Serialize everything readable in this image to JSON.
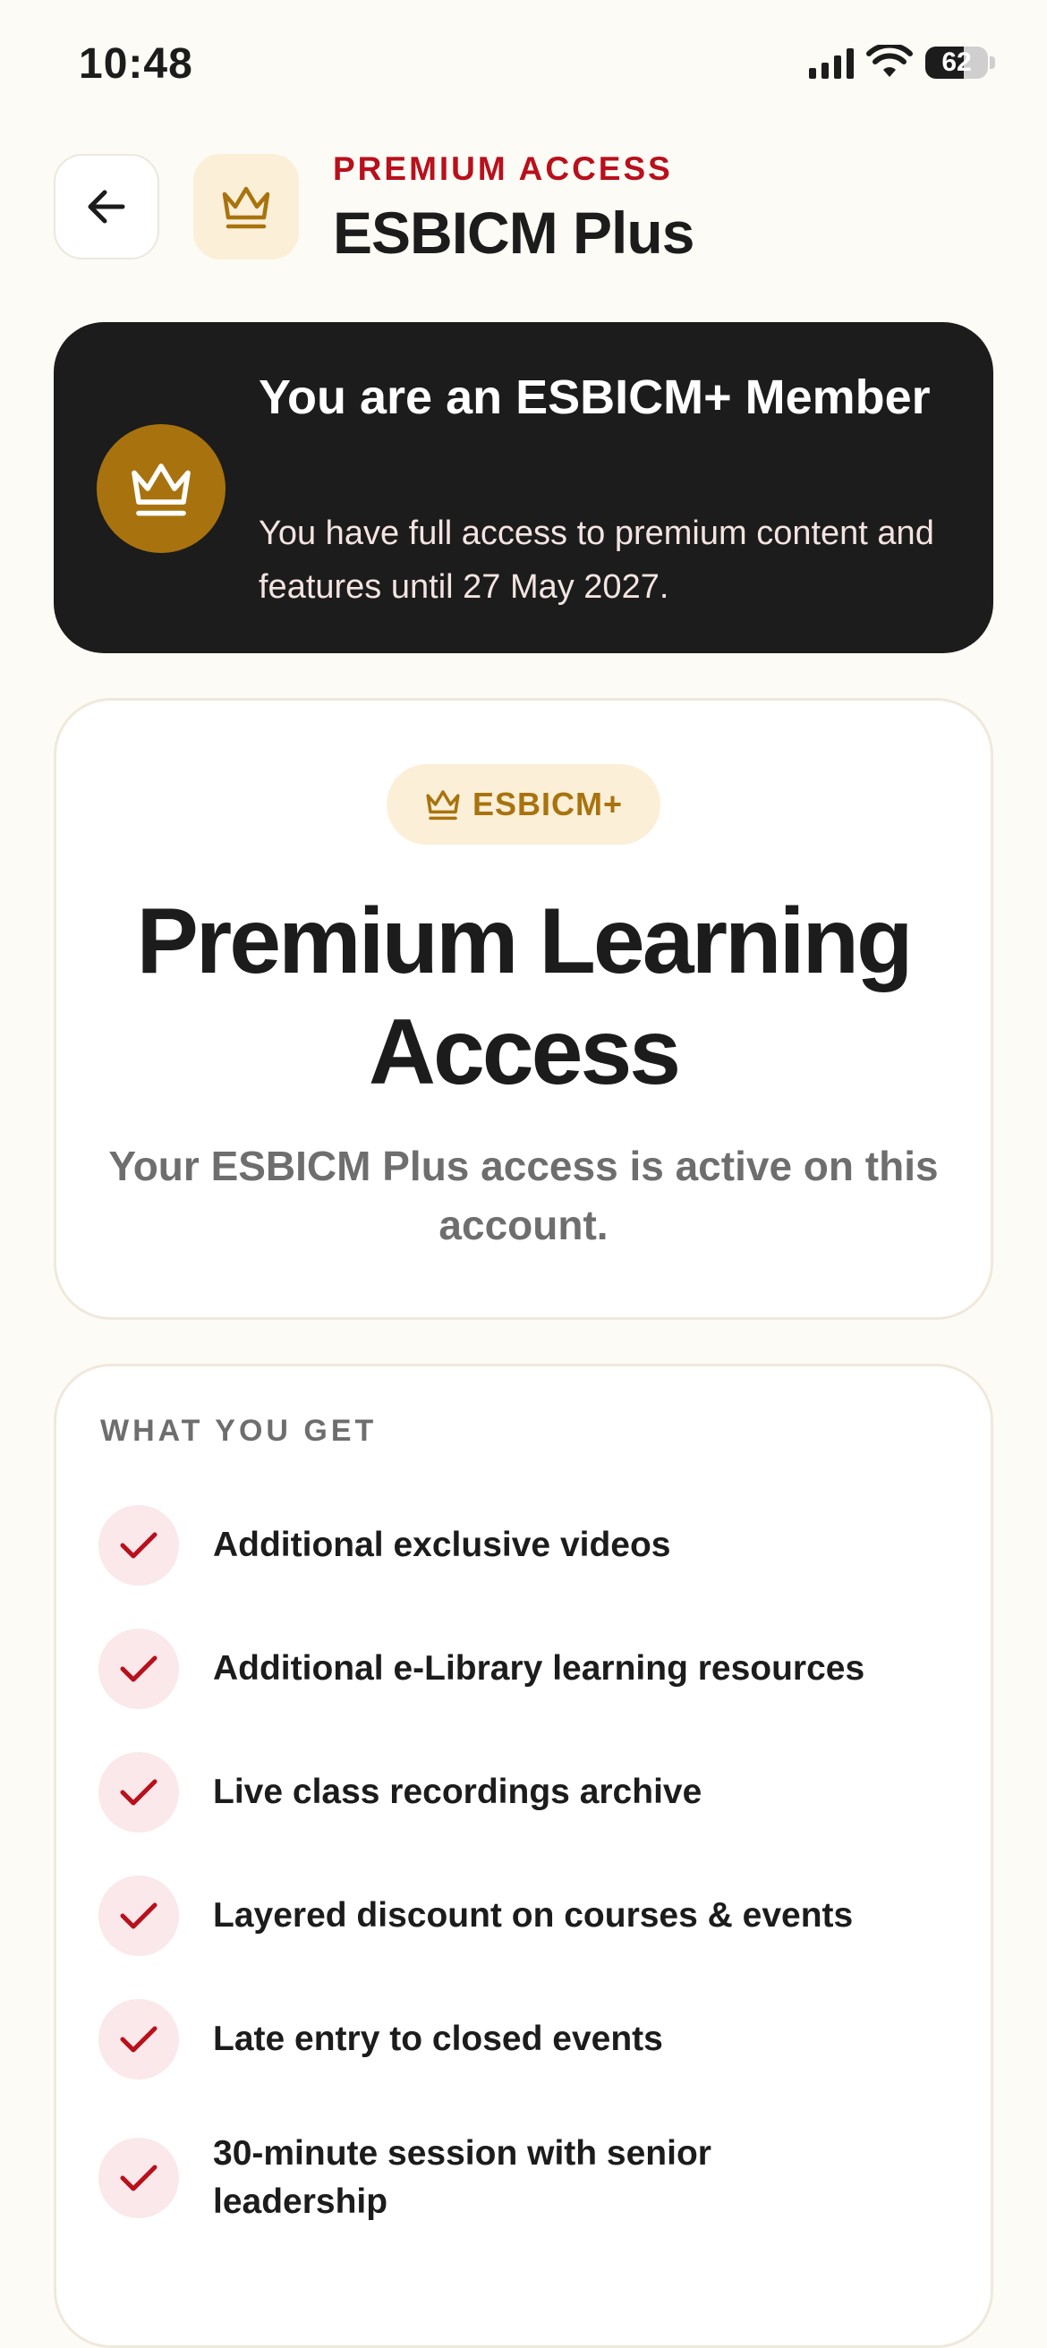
{
  "status_bar": {
    "time": "10:48",
    "battery": "62"
  },
  "header": {
    "eyebrow": "PREMIUM ACCESS",
    "title": "ESBICM Plus"
  },
  "member": {
    "title": "You are an ESBICM+ Member",
    "description": "You have full access to premium content and features until 27 May 2027."
  },
  "premium": {
    "pill_label": "ESBICM+",
    "title": "Premium Learning Access",
    "subtitle": "Your ESBICM Plus access is active on this account."
  },
  "benefits": {
    "heading": "WHAT YOU GET",
    "items": [
      "Additional exclusive videos",
      "Additional e-Library learning resources",
      "Live class recordings archive",
      "Layered discount on courses & events",
      "Late entry to closed events",
      "30-minute session with senior leadership"
    ]
  },
  "colors": {
    "accent_red": "#b8101c",
    "gold": "#a8730e",
    "dark": "#1c1c1c",
    "background": "#fdfbf5"
  }
}
